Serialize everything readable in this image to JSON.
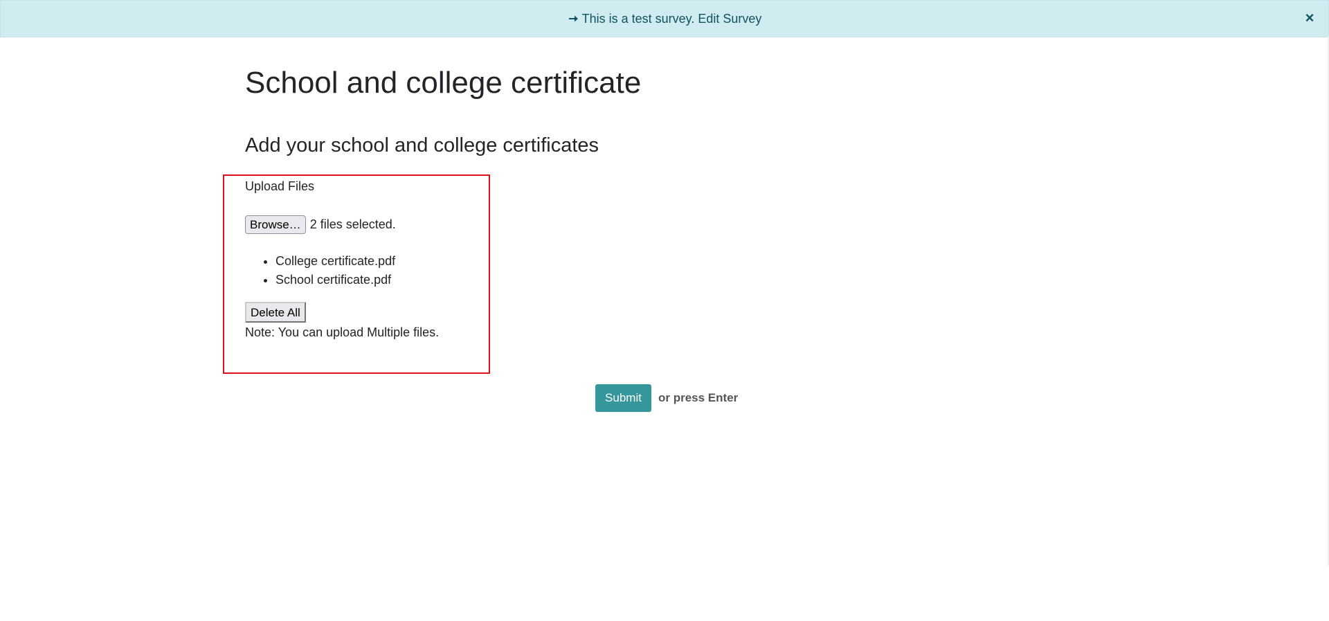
{
  "banner": {
    "icon": "arrow-right-icon",
    "text": "This is a test survey.",
    "link": "Edit Survey",
    "close_icon": "close-icon",
    "colors": {
      "background": "#d1ecf1",
      "text": "#0c5460"
    }
  },
  "survey": {
    "title": "School and college certificate",
    "section_title": "Add your school and college certificates",
    "question": {
      "label": "Upload Files",
      "browse_label": "Browse…",
      "files_selected": "2 files selected.",
      "files": [
        "College certificate.pdf",
        "School certificate.pdf"
      ],
      "delete_all_label": "Delete All",
      "note": "Note: You can upload Multiple files.",
      "highlight_color": "#e0101b"
    }
  },
  "footer": {
    "submit_label": "Submit",
    "hint": "or press Enter",
    "submit_color": "#35979c"
  }
}
